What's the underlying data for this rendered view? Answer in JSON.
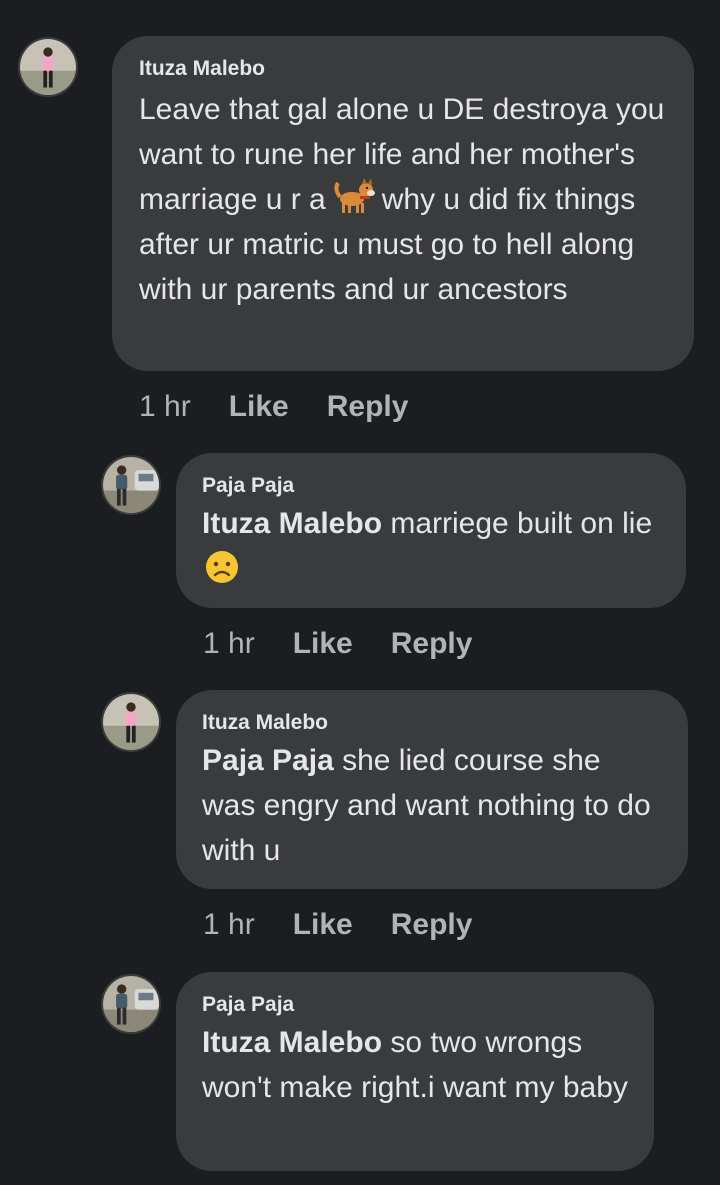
{
  "comments": [
    {
      "author": "Ituza Malebo",
      "text_part1": "Leave that gal alone u DE destroya you want to rune her life and her mother's marriage u r a",
      "emoji": "dog-emoji",
      "text_part2": "why u did fix things after ur matric u must go to hell along with ur parents and ur ancestors",
      "time": "1 hr",
      "like": "Like",
      "reply": "Reply"
    },
    {
      "author": "Paja Paja",
      "mention": "Ituza Malebo",
      "text": " marriege built on lie",
      "emoji": "sad-face-emoji",
      "time": "1 hr",
      "like": "Like",
      "reply": "Reply"
    },
    {
      "author": "Ituza Malebo",
      "mention": "Paja Paja",
      "text": " she lied course she was engry and want nothing to do with u",
      "time": "1 hr",
      "like": "Like",
      "reply": "Reply"
    },
    {
      "author": "Paja Paja",
      "mention": "Ituza Malebo",
      "text": " so two wrongs won't make right.i want my baby"
    }
  ],
  "colors": {
    "background": "#1c1d20",
    "bubble": "#3a3b3c",
    "primary_text": "#e4e6eb",
    "secondary_text": "#b0b3b8"
  }
}
